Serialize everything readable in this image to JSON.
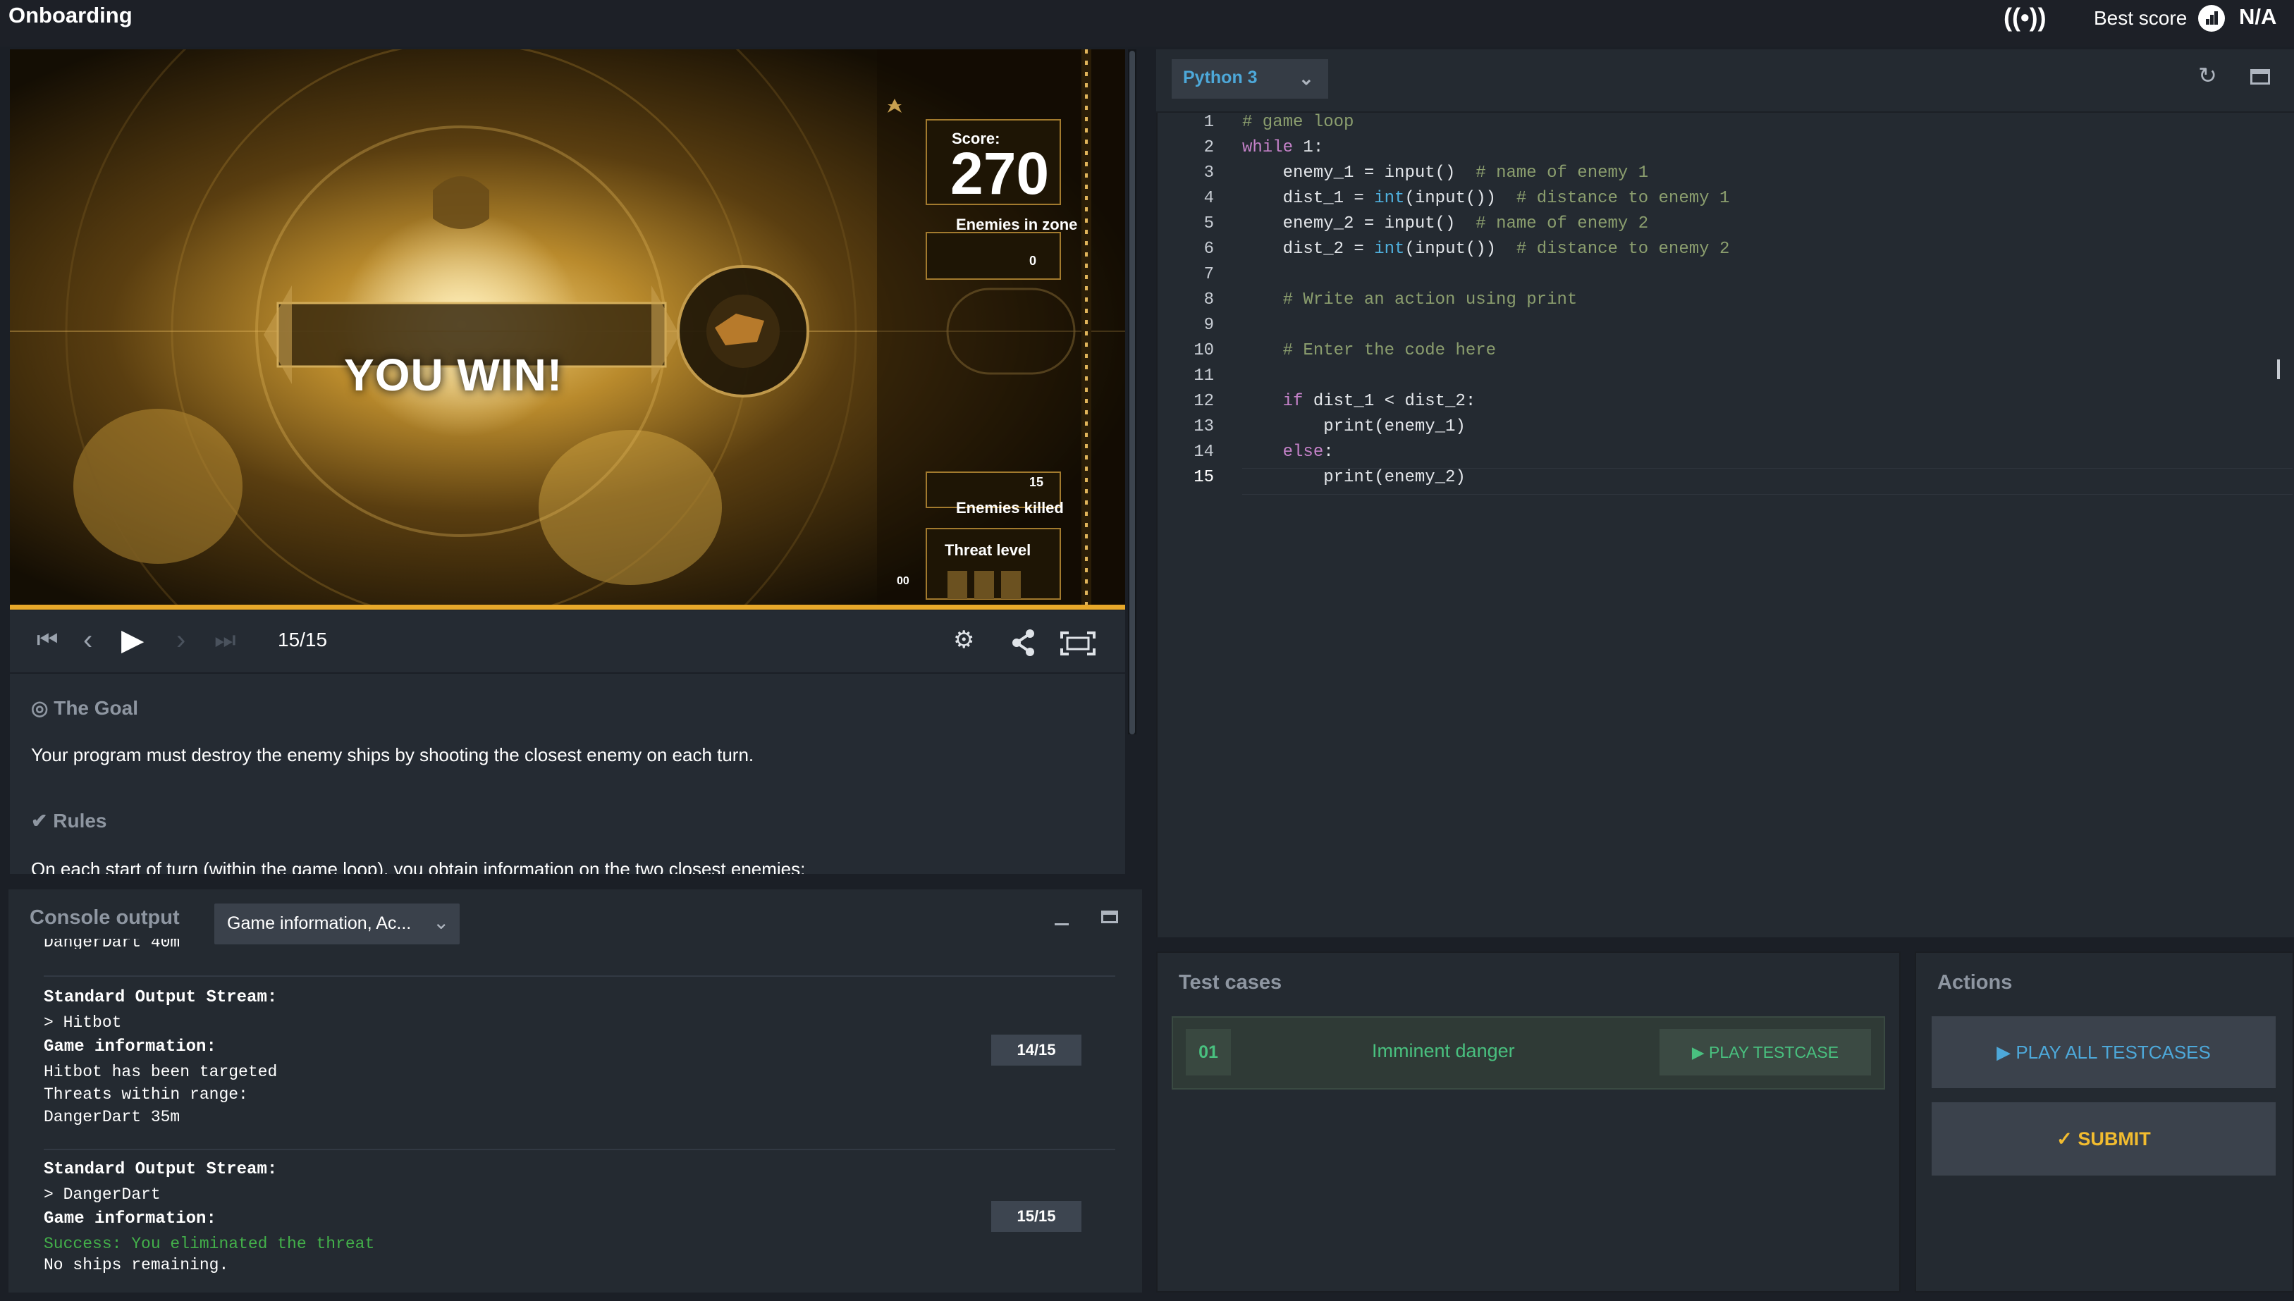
{
  "topbar": {
    "title": "Onboarding",
    "best_score_label": "Best score",
    "best_score_value": "N/A"
  },
  "game": {
    "banner": "YOU WIN!",
    "score_label": "Score:",
    "score_value": "270",
    "enemies_in_zone_label": "Enemies in zone",
    "enemies_in_zone_value": "0",
    "enemies_killed_label": "Enemies killed",
    "enemies_killed_value": "15",
    "threat_level_label": "Threat level",
    "threat_level_value": "00"
  },
  "player": {
    "frame": "15/15",
    "progress": 1.0
  },
  "description": {
    "goal_heading": "The Goal",
    "goal_text": "Your program must destroy the enemy ships by shooting the closest enemy on each turn.",
    "rules_heading": "Rules",
    "rules_text": "On each start of turn (within the game loop), you obtain information on the two closest enemies:"
  },
  "console": {
    "title": "Console output",
    "filter": "Game information, Ac...",
    "partial_line": "DangerDart 40m",
    "entries": [
      {
        "turn": "14/15",
        "stream_label": "Standard Output Stream:",
        "stream_value": "> Hitbot",
        "info_label": "Game information:",
        "lines": [
          "Hitbot has been targeted",
          "Threats within range:",
          "DangerDart 35m"
        ]
      },
      {
        "turn": "15/15",
        "stream_label": "Standard Output Stream:",
        "stream_value": "> DangerDart",
        "info_label": "Game information:",
        "success": "Success: You eliminated the threat",
        "lines": [
          "No ships remaining."
        ]
      }
    ]
  },
  "editor": {
    "language": "Python 3",
    "line_numbers": [
      "1",
      "2",
      "3",
      "4",
      "5",
      "6",
      "7",
      "8",
      "9",
      "10",
      "11",
      "12",
      "13",
      "14",
      "15"
    ]
  },
  "testcases": {
    "title": "Test cases",
    "items": [
      {
        "number": "01",
        "name": "Imminent danger",
        "play_label": "PLAY TESTCASE"
      }
    ]
  },
  "actions": {
    "title": "Actions",
    "play_all_label": "PLAY ALL TESTCASES",
    "submit_label": "SUBMIT"
  },
  "colors": {
    "accent_gold": "#e7a82a",
    "accent_blue": "#4da8d9",
    "accent_green": "#49c07f",
    "submit_yellow": "#f2bc2f"
  }
}
